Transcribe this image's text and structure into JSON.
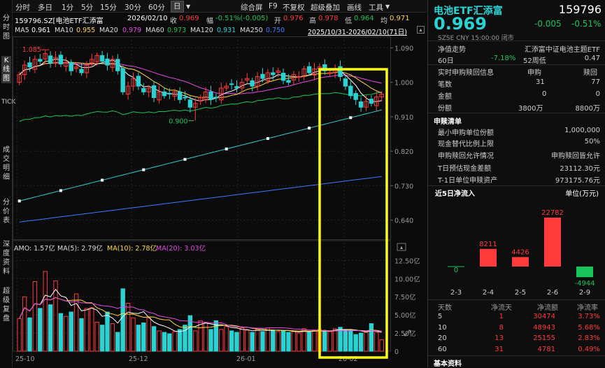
{
  "left_tabs": [
    "分时图",
    "K线图",
    "TICK",
    "成交明细",
    "分价表",
    "深度资料",
    "超级复盘"
  ],
  "toolbar": {
    "items": [
      "分时",
      "多日",
      "1分",
      "5分",
      "15分",
      "30分",
      "60分",
      "日",
      "▼"
    ],
    "right_items": [
      "综合屏",
      "F9",
      "不复权",
      "超级叠加",
      "画线",
      "工具",
      "▼"
    ]
  },
  "quote_bar": {
    "code_name": "159796.SZ[电池ETF汇添富",
    "date": "2026/02/10",
    "now_label": "收",
    "now_value": "0.969",
    "change_label": "幅",
    "change_value": "-0.51%(-0.005)",
    "open_label": "开",
    "open_value": "0.976",
    "high_label": "高",
    "high_value": "0.978",
    "low_label": "低",
    "low_value": "0.964",
    "avg_label": "均",
    "avg_value": "0.971"
  },
  "ma_bar": {
    "items": [
      {
        "label": "MA5",
        "value": "0.961",
        "color": "#ffffff"
      },
      {
        "label": "MA10",
        "value": "0.955",
        "color": "#ffd83a"
      },
      {
        "label": "MA20",
        "value": "0.979",
        "color": "#e84ae8"
      },
      {
        "label": "MA60",
        "value": "0.973",
        "color": "#19c55a"
      },
      {
        "label": "MA120",
        "value": "0.931",
        "color": "#2ad3d3"
      },
      {
        "label": "MA250",
        "value": "0.750",
        "color": "#3a7bff"
      }
    ],
    "range_text": "2025/10/31-2026/02/10(71日)"
  },
  "price_axis": [
    "1.090",
    "1.000",
    "0.910",
    "0.820",
    "0.730",
    "0.640"
  ],
  "annotations": {
    "high": "1.085",
    "low": "0.900"
  },
  "amo_bar": {
    "amo": "AMO: 1.57亿",
    "ma5": "MA(5): 2.79亿",
    "ma10": "MA(10): 2.78亿",
    "ma20": "MA(20): 3.03亿"
  },
  "volume_axis": [
    "12.50亿",
    "10.00亿",
    "7.50亿",
    "5.00亿",
    "2.50亿",
    "0"
  ],
  "date_axis": [
    "25-10",
    "25-12",
    "26-01",
    "26-02"
  ],
  "right": {
    "title": "电池ETF汇添富",
    "code": "159796",
    "price": "0.969",
    "change": "-0.005",
    "change_pct": "-0.51%",
    "meta": "SZSE  CNY  15:00:00  闭市",
    "nav_label": "净值走势",
    "nav_value": "汇添富中证电池主题ETF",
    "d60_label": "60日",
    "d60_value": "-7.18%",
    "w52_label": "52周低",
    "w52_value": "0.47",
    "sub_redeem": {
      "title": "实时申购赎回信息",
      "col1": "申购",
      "col2": "赎回",
      "rows": [
        {
          "label": "笔数",
          "a": "31",
          "b": "77"
        },
        {
          "label": "金额",
          "a": "0",
          "b": "0"
        },
        {
          "label": "份额",
          "a": "3800万",
          "b": "8800万"
        }
      ]
    },
    "list": {
      "title": "申赎清单",
      "rows": [
        {
          "label": "最小申购单位份额",
          "value": "1,000,000"
        },
        {
          "label": "现金替代比例上限",
          "value": "50%"
        },
        {
          "label": "申购赎回允许情况",
          "value": "申购赎回皆允许"
        },
        {
          "label": "T日预估现金差额",
          "value": "23112.30元"
        },
        {
          "label": "T-1日单位申赎资产",
          "value": "973175.76元"
        }
      ]
    },
    "flow": {
      "title": "近5日净流入",
      "unit": "单位(万元)",
      "dates": [
        "2-3",
        "2-4",
        "2-5",
        "2-6",
        "2-9"
      ],
      "values": [
        0,
        8211,
        4426,
        22782,
        -4944
      ],
      "labels": [
        "0",
        "8211",
        "4426",
        "22782",
        "-4944"
      ]
    },
    "flow_table": {
      "headers": [
        "天数",
        "净流天",
        "净流额",
        "净流率"
      ],
      "rows": [
        {
          "d": "5",
          "days": "1",
          "amt": "30474",
          "rate": "3.73%"
        },
        {
          "d": "10",
          "days": "8",
          "amt": "48943",
          "rate": "5.68%"
        },
        {
          "d": "20",
          "days": "13",
          "amt": "25155",
          "rate": "2.83%"
        },
        {
          "d": "60",
          "days": "31",
          "amt": "4781",
          "rate": "0.49%"
        }
      ]
    },
    "basic_label": "基本资料"
  },
  "colors": {
    "up": "#ff3b3b",
    "down": "#2ad3d3",
    "highlight": "#ffff00"
  }
}
